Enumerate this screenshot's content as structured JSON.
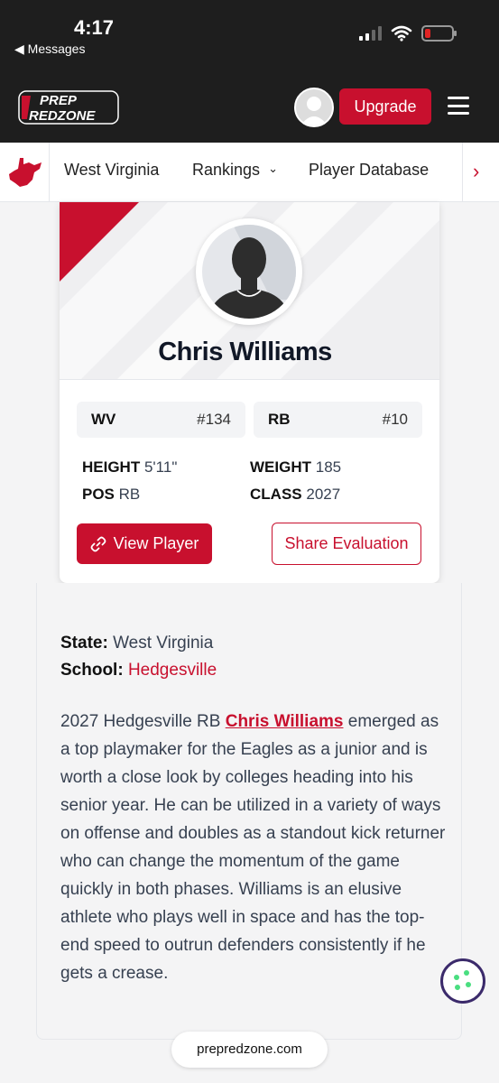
{
  "status_bar": {
    "time": "4:17",
    "back_app": "◀ Messages",
    "battery_level": 0.2
  },
  "header": {
    "logo_line1": "PREP",
    "logo_line2": "REDZONE",
    "upgrade_label": "Upgrade",
    "brand_color": "#c8102e"
  },
  "nav": {
    "state": "West Virginia",
    "rankings": "Rankings",
    "rankings_chevron": "⌄",
    "player_database": "Player Database",
    "next": "›"
  },
  "player": {
    "name": "Chris Williams",
    "state_abbr": "WV",
    "state_rank": "#134",
    "position": "RB",
    "position_rank": "#10",
    "height_label": "HEIGHT",
    "height": "5'11\"",
    "weight_label": "WEIGHT",
    "weight": "185",
    "pos_label": "POS",
    "pos": "RB",
    "class_label": "CLASS",
    "class": "2027",
    "view_label": "View Player",
    "share_label": "Share Evaluation"
  },
  "article": {
    "state_label": "State:",
    "state_value": "West Virginia",
    "school_label": "School:",
    "school_value": "Hedgesville",
    "text_before": "2027 Hedgesville RB ",
    "player_link": "Chris Williams",
    "text_after": " emerged as a top playmaker for the Eagles as a junior and is worth a close look by colleges heading into his senior year. He can be utilized in a variety of ways on offense and doubles as a standout kick returner who can change the momentum of the game quickly in both phases. Williams is an elusive athlete who plays well in space and has the top-end speed to outrun defenders consistently if he gets a crease."
  },
  "browser": {
    "url": "prepredzone.com"
  }
}
